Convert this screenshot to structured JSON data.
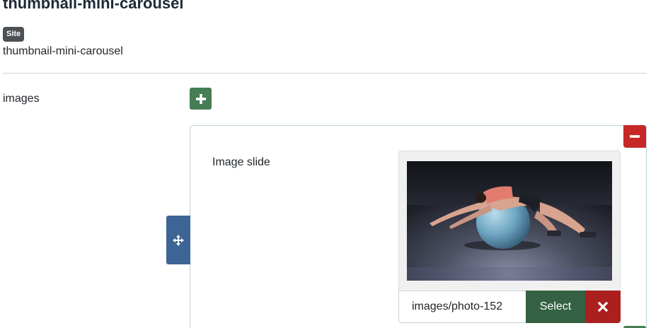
{
  "module": {
    "title": "thumbnail-mini-carousel",
    "badge": "Site",
    "subtitle": "thumbnail-mini-carousel"
  },
  "field": {
    "label": "images"
  },
  "row": {
    "slide_label": "Image slide",
    "media": {
      "path_value": "images/photo-152",
      "select_label": "Select"
    }
  },
  "icons": {
    "add": "plus-icon",
    "remove": "minus-icon",
    "drag": "move-arrows-icon",
    "clear": "close-icon"
  },
  "colors": {
    "add_green": "#457d54",
    "select_green": "#346143",
    "remove_red": "#c52827",
    "clear_red": "#ab1f1f",
    "drag_blue": "#3d6596",
    "badge_gray": "#4d5156"
  }
}
